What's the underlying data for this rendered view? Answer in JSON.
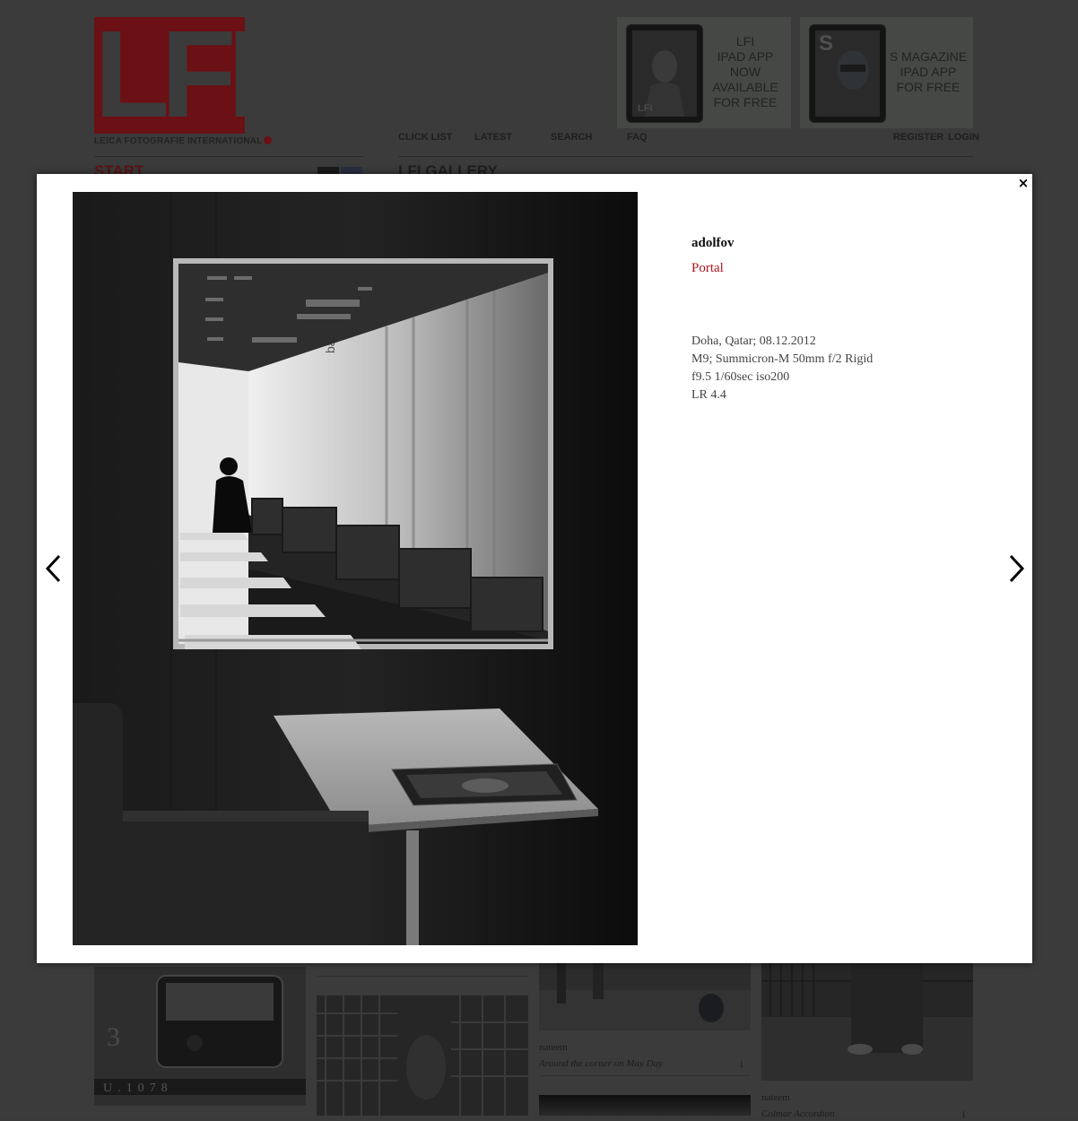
{
  "header": {
    "logo_text": "LFI",
    "logo_subtitle": "LEICA FOTOGRAFIE INTERNATIONAL",
    "promo_lfi": [
      "LFI",
      "IPAD APP",
      "NOW",
      "AVAILABLE",
      "FOR FREE"
    ],
    "promo_s": [
      "S MAGAZINE",
      "IPAD APP",
      "FOR FREE"
    ],
    "promo_lfi_thumb_label": "LFI",
    "promo_s_thumb_label": "S",
    "nav": {
      "click_list": "CLICK LIST",
      "latest": "LATEST",
      "search": "SEARCH",
      "faq": "FAQ"
    },
    "account": {
      "register": "REGISTER",
      "login": "LOGIN"
    }
  },
  "page": {
    "start": "START",
    "section_title": "LFI GALLERY"
  },
  "gallery_tiles": [
    {
      "author": "nateem",
      "title": "Around the corner on May Day",
      "info": "i"
    },
    {
      "author": "nateem",
      "title": "Colmar Accordion",
      "info": "i"
    }
  ],
  "lightbox": {
    "author": "adolfov",
    "album": "Portal",
    "description": [
      "Doha, Qatar; 08.12.2012",
      "M9; Summicron-M 50mm f/2 Rigid",
      "f9.5 1/60sec iso200",
      "LR 4.4"
    ],
    "close_icon": "close-icon",
    "prev_icon": "chevron-left-icon",
    "next_icon": "chevron-right-icon",
    "photo_sign_text": "balance"
  },
  "colors": {
    "brand_red": "#b0141c",
    "overlay_bg": "#3b3b3b",
    "lightbox_bg": "#ffffff"
  }
}
